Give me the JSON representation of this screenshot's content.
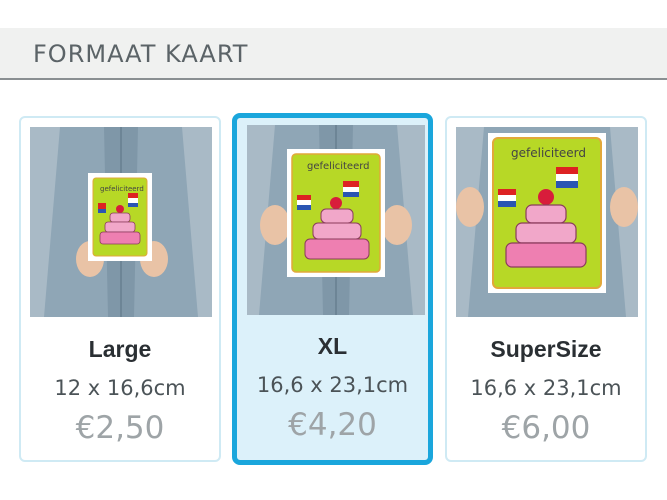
{
  "header": {
    "title": "FORMAAT KAART"
  },
  "card_text": "gefeliciteerd",
  "colors": {
    "accent": "#1aa6dc",
    "selected_bg": "#dcf1fa",
    "card_green": "#b7d826",
    "frosting_pink": "#ee7fb1"
  },
  "options": [
    {
      "name": "Large",
      "size": "12 x 16,6cm",
      "price": "€2,50",
      "selected": false
    },
    {
      "name": "XL",
      "size": "16,6 x 23,1cm",
      "price": "€4,20",
      "selected": true
    },
    {
      "name": "SuperSize",
      "size": "16,6 x 23,1cm",
      "price": "€6,00",
      "selected": false
    }
  ]
}
